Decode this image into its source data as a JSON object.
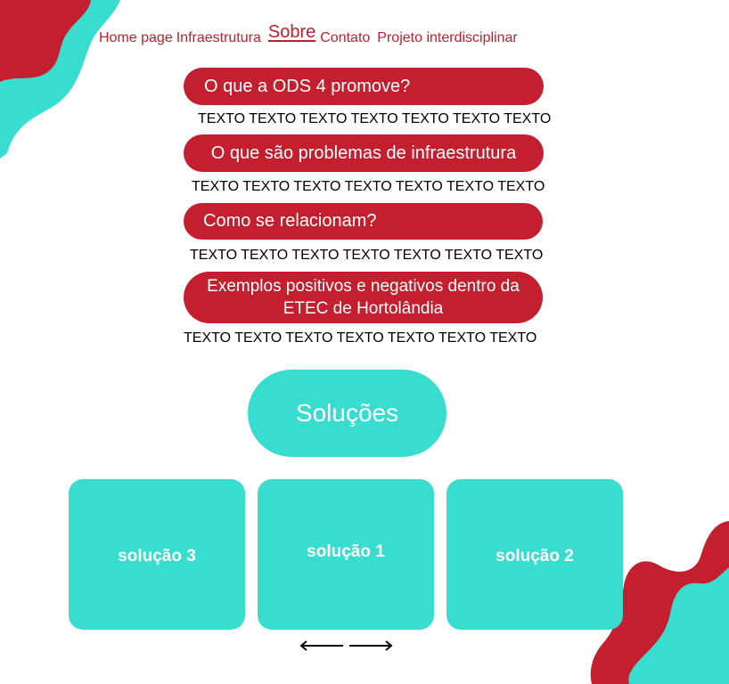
{
  "colors": {
    "accent_red": "#c41f2f",
    "accent_teal": "#39ddd0",
    "text": "#000000"
  },
  "nav": {
    "items": [
      {
        "label": "Home page"
      },
      {
        "label": "Infraestrutura"
      },
      {
        "label": "Sobre"
      },
      {
        "label": "Contato"
      },
      {
        "label": "Projeto interdisciplinar"
      }
    ]
  },
  "sections": [
    {
      "heading": "O que a ODS 4 promove?",
      "text": "TEXTO TEXTO TEXTO TEXTO TEXTO TEXTO TEXTO"
    },
    {
      "heading": "O que são problemas de infraestrutura",
      "text": "TEXTO TEXTO TEXTO TEXTO TEXTO TEXTO TEXTO"
    },
    {
      "heading": "Como se relacionam?",
      "text": "TEXTO TEXTO TEXTO TEXTO TEXTO TEXTO TEXTO"
    },
    {
      "heading_line1": "Exemplos positivos e negativos dentro da",
      "heading_line2": "ETEC de Hortolândia",
      "text": "TEXTO TEXTO TEXTO TEXTO TEXTO TEXTO TEXTO"
    }
  ],
  "solutions": {
    "title": "Soluções",
    "cards": [
      {
        "label": "solução 3"
      },
      {
        "label": "solução 1"
      },
      {
        "label": "solução 2"
      }
    ],
    "carousel_icons": [
      "arrow-left-icon",
      "arrow-right-icon"
    ]
  }
}
